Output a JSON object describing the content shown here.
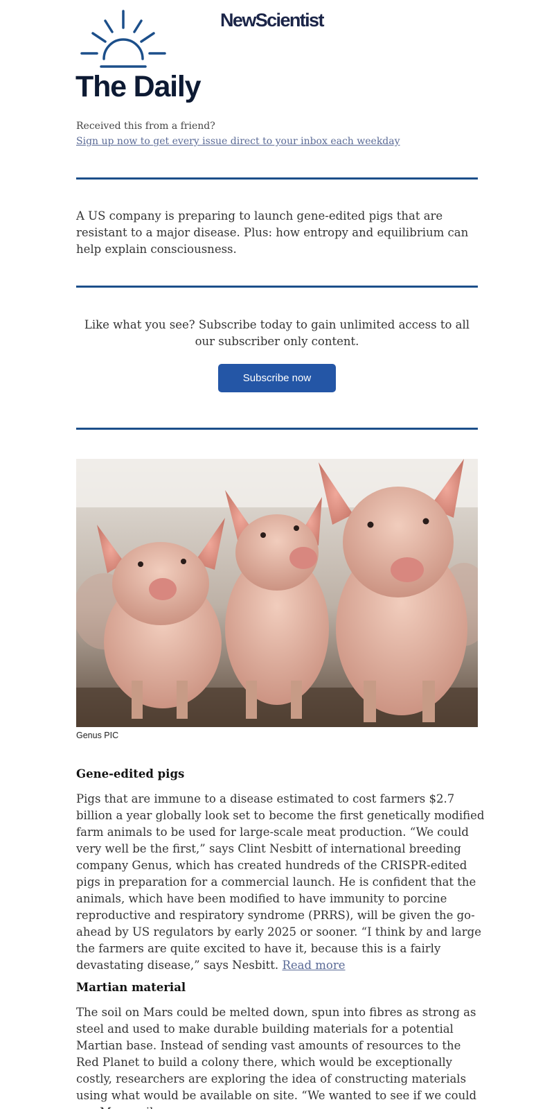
{
  "header": {
    "logo_icon": "sunrise-icon",
    "brand": "NewScientist",
    "newsletter_title": "The Daily",
    "friend_prompt": "Received this from a friend?",
    "signup_link": "Sign up now to get every issue direct to your inbox each weekday"
  },
  "intro": {
    "text": "A US company is preparing to launch gene-edited pigs that are resistant to a major disease. Plus: how entropy and equilibrium can help explain consciousness."
  },
  "promo": {
    "text": "Like what you see? Subscribe today to gain unlimited access to all our subscriber only content.",
    "button_label": "Subscribe now"
  },
  "hero": {
    "caption": "Genus PIC"
  },
  "stories": [
    {
      "heading": "Gene-edited pigs",
      "body": "Pigs that are immune to a disease estimated to cost farmers $2.7 billion a year globally look set to become the first genetically modified farm animals to be used for large-scale meat production. “We could very well be the first,” says Clint Nesbitt of international breeding company Genus, which has created hundreds of the CRISPR-edited pigs in preparation for a commercial launch. He is confident that the animals, which have been modified to have immunity to porcine reproductive and respiratory syndrome (PRRS), will be given the go-ahead by US regulators by early 2025 or sooner. “I think by and large the farmers are quite excited to have it, because this is a fairly devastating disease,” says Nesbitt.",
      "link": "Read more"
    },
    {
      "heading": "Martian material",
      "body": "The soil on Mars could be melted down, spun into fibres as strong as steel and used to make durable building materials for a potential Martian base. Instead of sending vast amounts of resources to the Red Planet to build a colony there, which would be exceptionally costly, researchers are exploring the idea of constructing materials using what would be available on site. “We wanted to see if we could use Mars soil"
    }
  ],
  "colors": {
    "accent": "#1c4f8a",
    "button": "#2456a6",
    "link": "#5a6a96",
    "title": "#0d1a33"
  }
}
